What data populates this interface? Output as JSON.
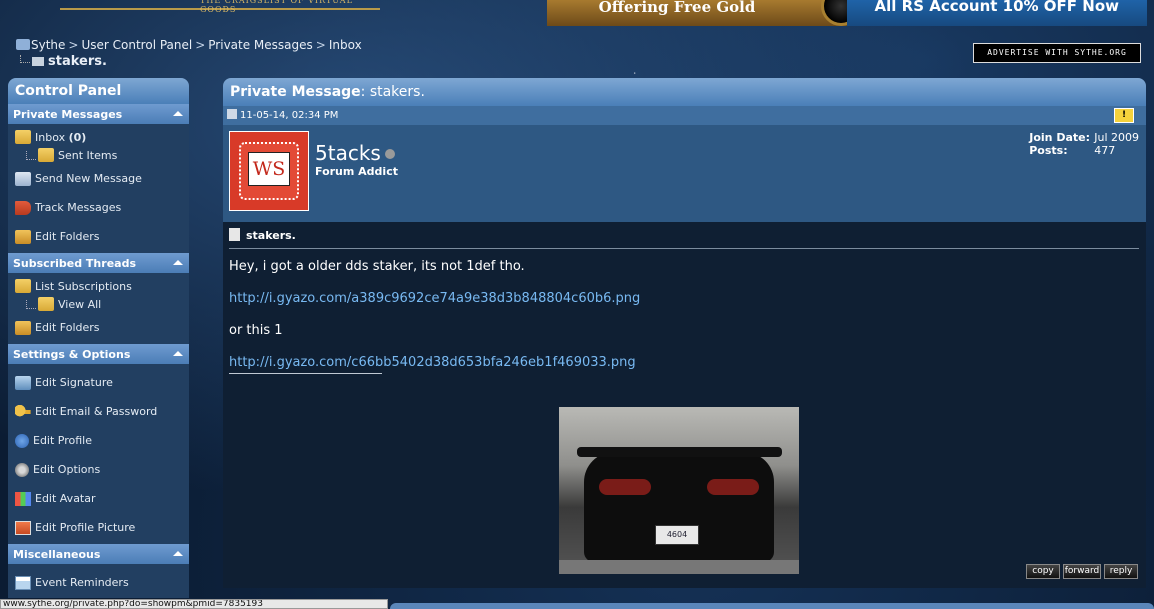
{
  "top_banner": {
    "tagline": "THE CRAIGSLIST OF VIRTUAL GOODS",
    "ad_gold": "Offering Free Gold",
    "ad_rs": "All RS Account 10% OFF Now"
  },
  "breadcrumb": {
    "items": [
      "Sythe",
      "User Control Panel",
      "Private Messages",
      "Inbox"
    ],
    "current": "stakers."
  },
  "advertise_label": "ADVERTISE WITH SYTHE.ORG",
  "sidebar": {
    "title": "Control Panel",
    "sections": {
      "pm": {
        "heading": "Private Messages",
        "inbox_label": "Inbox",
        "inbox_count": "(0)",
        "sent_items": "Sent Items",
        "send_new": "Send New Message",
        "track": "Track Messages",
        "edit_folders": "Edit Folders"
      },
      "subs": {
        "heading": "Subscribed Threads",
        "list": "List Subscriptions",
        "view_all": "View All",
        "edit_folders": "Edit Folders"
      },
      "settings": {
        "heading": "Settings & Options",
        "edit_signature": "Edit Signature",
        "edit_email": "Edit Email & Password",
        "edit_profile": "Edit Profile",
        "edit_options": "Edit Options",
        "edit_avatar": "Edit Avatar",
        "edit_profile_picture": "Edit Profile Picture"
      },
      "misc": {
        "heading": "Miscellaneous",
        "event_reminders": "Event Reminders"
      }
    }
  },
  "message": {
    "header_label": "Private Message",
    "header_subject": ": stakers.",
    "date": "11-05-14, 02:34 PM",
    "report_icon": "warning-icon",
    "avatar_text": "WS",
    "username": "5tacks",
    "user_title": "Forum Addict",
    "join_date_label": "Join Date:",
    "join_date": "Jul 2009",
    "posts_label": "Posts:",
    "posts": "477",
    "title": "stakers.",
    "line1": "Hey, i got a older dds staker, its not 1def tho.",
    "link1": "http://i.gyazo.com/a389c9692ce74a9e38d3b848804c60b6.png",
    "line2": "or this 1",
    "link2": "http://i.gyazo.com/c66bb5402d38d653bfa246eb1f469033.png",
    "signature_plate": "4604",
    "buttons": {
      "copy": "copy",
      "forward": "forward",
      "reply": "reply"
    }
  },
  "status_bar_url": "www.sythe.org/private.php?do=showpm&pmid=7835193"
}
